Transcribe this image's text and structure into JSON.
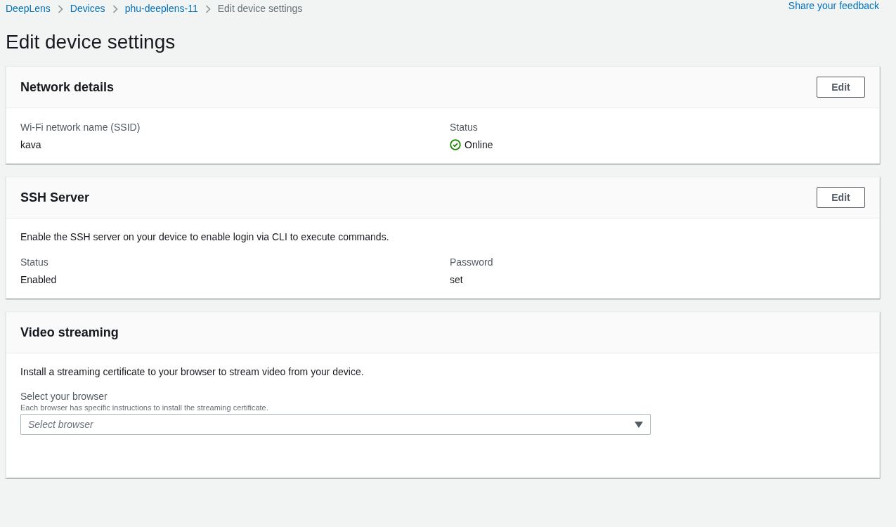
{
  "breadcrumbs": [
    {
      "label": "DeepLens",
      "kind": "link"
    },
    {
      "label": "Devices",
      "kind": "link"
    },
    {
      "label": "phu-deeplens-11",
      "kind": "link"
    },
    {
      "label": "Edit device settings",
      "kind": "current"
    }
  ],
  "feedback_link": "Share your feedback",
  "title": "Edit device settings",
  "panels": [
    {
      "title": "Network details",
      "edit_button": "Edit",
      "fields": [
        {
          "label": "Wi-Fi network name (SSID)",
          "value": "kava",
          "kind": "text"
        },
        {
          "label": "Status",
          "value": "Online",
          "kind": "success"
        }
      ]
    },
    {
      "title": "SSH Server",
      "edit_button": "Edit",
      "description": "Enable the SSH server on your device to enable login via CLI to execute commands.",
      "fields": [
        {
          "label": "Status",
          "value": "Enabled"
        },
        {
          "label": "Password",
          "value": "set"
        }
      ]
    },
    {
      "title": "Video streaming",
      "description": "Install a streaming certificate to your browser to stream video from your device.",
      "select": {
        "label": "Select your browser",
        "hint": "Each browser has specific instructions to install the streaming certificate.",
        "placeholder": "Select browser"
      }
    }
  ]
}
